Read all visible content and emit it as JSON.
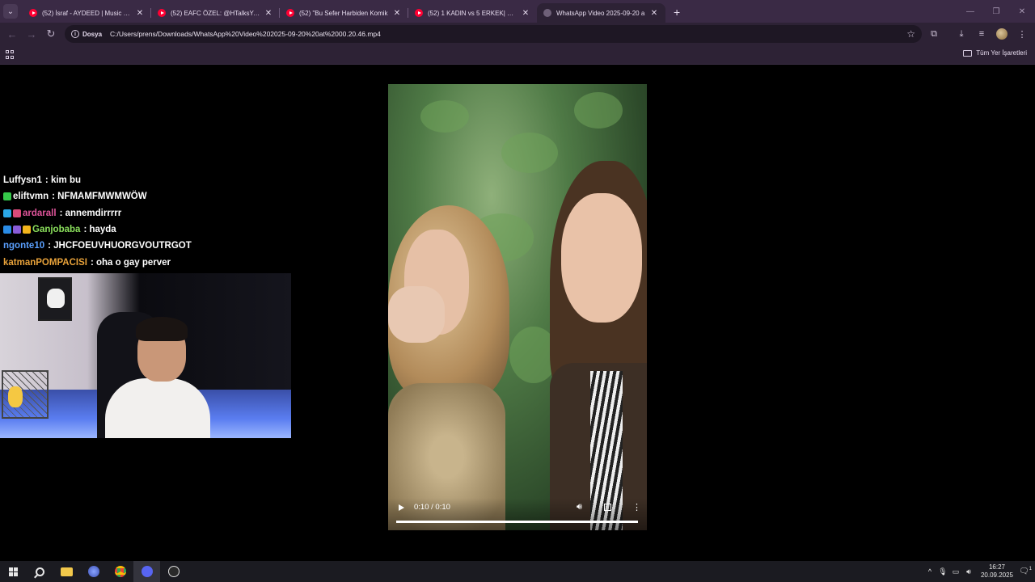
{
  "browser": {
    "tabs": [
      {
        "title": "(52) İsraf - AYDEED | Music Vid",
        "type": "youtube",
        "active": false
      },
      {
        "title": "(52) EAFC ÖZEL: @HTalksYoutu",
        "type": "youtube",
        "active": false
      },
      {
        "title": "(52) \"Bu Sefer Harbiden Komik",
        "type": "youtube",
        "active": false
      },
      {
        "title": "(52) 1 KADIN vs 5 ERKEK| KIYAF",
        "type": "youtube",
        "active": false
      },
      {
        "title": "WhatsApp Video 2025-09-20 a",
        "type": "file",
        "active": true
      }
    ],
    "close_glyph": "✕",
    "new_tab_glyph": "+",
    "omnibox": {
      "chip": "Dosya",
      "url": "C:/Users/prens/Downloads/WhatsApp%20Video%202025-09-20%20at%2000.20.46.mp4"
    },
    "bookmarks": {
      "all_bookmarks": "Tüm Yer İşaretleri"
    }
  },
  "chat": [
    {
      "user": "Luffysn1",
      "message": " : kim bu",
      "color": "#ffffff",
      "badges": []
    },
    {
      "user": "eliftvmn",
      "message": " : NFMAMFMWMWÖW",
      "color": "#ffffff",
      "badges": [
        "#35c94a"
      ]
    },
    {
      "user": "ardarall",
      "message": " : annemdirrrrr",
      "color": "#e0559b",
      "badges": [
        "#2aa7e6",
        "#d94a7a"
      ]
    },
    {
      "user": "Ganjobaba",
      "message": " : hayda",
      "color": "#8be05c",
      "badges": [
        "#2a8ce6",
        "#8a5cd9",
        "#f2b41c"
      ]
    },
    {
      "user": "ngonte10",
      "message": " : JHCFOEUVHUORGVOUTRGOT",
      "color": "#5aa0ff",
      "badges": []
    },
    {
      "user": "katmanPOMPACISI",
      "message": " : oha o gay perver",
      "color": "#e8a23a",
      "badges": []
    }
  ],
  "video": {
    "time": "0:10 / 0:10",
    "progress": 1.0
  },
  "taskbar": {
    "time": "16:27",
    "date": "20.09.2025",
    "notif_count": "1"
  }
}
